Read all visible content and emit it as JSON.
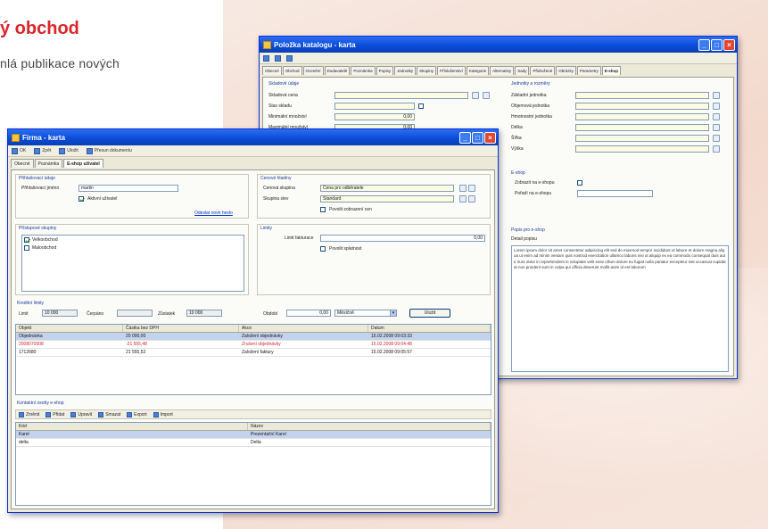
{
  "heading": "ý obchod",
  "subtext": "nlá publikace nových",
  "colors": {
    "accent": "#d9252b",
    "titlebar": "#0a4bd6",
    "window_bg": "#ece9d8"
  },
  "back_window": {
    "title": "Položka katalogu - karta",
    "tabs": [
      "Obecné",
      "Obchod",
      "Ocenění",
      "Dodavatelé",
      "Poznámka",
      "Popisy",
      "Jednotky",
      "Skupiny",
      "Příslušenství",
      "Kategorie",
      "Alternativy",
      "Sady",
      "Přidružené",
      "Obrázky",
      "Parametry",
      "E-shop"
    ],
    "active_tab": 15,
    "left_fields": [
      "Skladová cena",
      "Stav skladu",
      "Minimální množství",
      "Maximální množství"
    ],
    "left_values": [
      "",
      "",
      "0,00",
      "0,00"
    ],
    "right_fields": [
      "Základní jednotka",
      "Objemová jednotka",
      "Hmotnostní jednotka",
      "Délka",
      "Šířka",
      "Výška"
    ],
    "group_bottom_label": "Popis pro e-shop",
    "description_label": "Detail popisu",
    "description_text": "Lorem ipsum dolor sit amet consectetur adipiscing elit sed do eiusmod tempor incididunt ut labore et dolore magna aliqua ut enim ad minim veniam quis nostrud exercitation ullamco laboris nisi ut aliquip ex ea commodo consequat duis aute irure dolor in reprehenderit in voluptate velit esse cillum dolore eu fugiat nulla pariatur excepteur sint occaecat cupidatat non proident sunt in culpa qui officia deserunt mollit anim id est laborum"
  },
  "front_window": {
    "title": "Firma - karta",
    "toolbar": [
      "OK",
      "Zpět",
      "Uložit",
      "Přesun dokumentu"
    ],
    "tabs": [
      "Obecné",
      "Poznámka",
      "E-shop uživatel"
    ],
    "group_login": {
      "label": "Přihlašovací údaje",
      "field_label": "Přihlašovací jméno",
      "field_value": "martin",
      "checkbox_label": "Aktivní uživatel",
      "link": "Odeslat nové heslo"
    },
    "group_access": {
      "label": "Přístupové skupiny",
      "items": [
        {
          "label": "Velkoobchod",
          "checked": true
        },
        {
          "label": "Maloobchod",
          "checked": false
        }
      ]
    },
    "group_price": {
      "label": "Cenové hladiny",
      "field1_label": "Cenová skupina",
      "field1_value": "Cena pro odběratele",
      "field2_label": "Skupina slev",
      "field2_value": "Standard",
      "checkbox_label": "Povolit zobrazení cen"
    },
    "group_limits": {
      "label": "Limity",
      "field_label": "Limit fakturace",
      "field_value": "0,00",
      "checkbox_label": "Povolit splatnost"
    },
    "credit_section": {
      "label": "Kreditní limity",
      "limit_label": "Limit",
      "limit_value": "10 000",
      "used_label": "Čerpáno",
      "used_value": "",
      "free_label": "Zůstatek",
      "free_value": "10 000",
      "period_label": "Období",
      "period_value": "0,00",
      "period_select": "Měsíčně",
      "button": "Uložit"
    },
    "table1": {
      "columns": [
        "Objekt",
        "Částka bez DPH",
        "Akce",
        "Datum"
      ],
      "rows": [
        {
          "cells": [
            "Objednávka",
            "20 000,00",
            "Založení objednávky",
            "15.02.2008 09:03:33"
          ],
          "style": "selected"
        },
        {
          "cells": [
            "2008070008",
            "-21 555,48",
            "Zrušení objednávky",
            "15.02.2008 09:04:48"
          ],
          "style": "red"
        },
        {
          "cells": [
            "1712680",
            "21 555,52",
            "Založení faktury",
            "15.02.2008 09:05:57"
          ],
          "style": "normal"
        }
      ]
    },
    "list_section": {
      "label": "Kontaktní osoby e-shop",
      "toolbar": [
        "Změnit",
        "Přidat",
        "Upravit",
        "Smazat",
        "Export",
        "Import"
      ],
      "columns": [
        "Kód",
        "Název"
      ],
      "rows": [
        {
          "cells": [
            "Karel",
            "Prezentační Karel"
          ],
          "style": "selected"
        },
        {
          "cells": [
            "delta",
            "Delta"
          ],
          "style": "normal"
        }
      ]
    }
  }
}
